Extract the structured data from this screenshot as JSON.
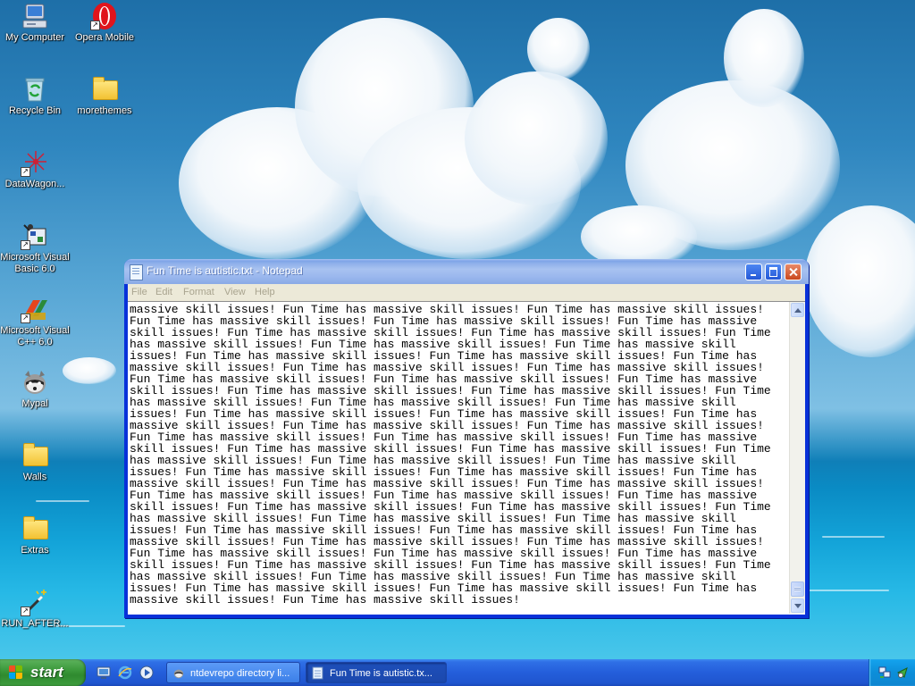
{
  "desktop": {
    "icons": [
      {
        "label": "My Computer",
        "icon": "my-computer-icon"
      },
      {
        "label": "Opera Mobile",
        "icon": "opera-icon"
      },
      {
        "label": "Recycle Bin",
        "icon": "recycle-bin-icon"
      },
      {
        "label": "morethemes",
        "icon": "folder-icon"
      },
      {
        "label": "DataWagon...",
        "icon": "datawagon-icon"
      },
      {
        "label": "Microsoft Visual Basic 6.0",
        "icon": "visual-basic-icon"
      },
      {
        "label": "Microsoft Visual C++ 6.0",
        "icon": "visual-cpp-icon"
      },
      {
        "label": "Mypal",
        "icon": "mypal-icon"
      },
      {
        "label": "Walls",
        "icon": "folder-icon"
      },
      {
        "label": "Extras",
        "icon": "folder-icon"
      },
      {
        "label": "RUN_AFTER...",
        "icon": "wand-icon"
      }
    ]
  },
  "notepad": {
    "title": "Fun Time is autistic.txt - Notepad",
    "menu": [
      "File",
      "Edit",
      "Format",
      "View",
      "Help"
    ],
    "text_lines": [
      "massive skill issues! Fun Time has massive skill issues! Fun Time has massive skill issues!",
      "Fun Time has massive skill issues! Fun Time has massive skill issues! Fun Time has massive",
      "skill issues! Fun Time has massive skill issues! Fun Time has massive skill issues! Fun Time",
      "has massive skill issues! Fun Time has massive skill issues! Fun Time has massive skill",
      "issues! Fun Time has massive skill issues! Fun Time has massive skill issues! Fun Time has",
      "massive skill issues! Fun Time has massive skill issues! Fun Time has massive skill issues!",
      "Fun Time has massive skill issues! Fun Time has massive skill issues! Fun Time has massive",
      "skill issues! Fun Time has massive skill issues! Fun Time has massive skill issues! Fun Time",
      "has massive skill issues! Fun Time has massive skill issues! Fun Time has massive skill",
      "issues! Fun Time has massive skill issues! Fun Time has massive skill issues! Fun Time has",
      "massive skill issues! Fun Time has massive skill issues! Fun Time has massive skill issues!",
      "Fun Time has massive skill issues! Fun Time has massive skill issues! Fun Time has massive",
      "skill issues! Fun Time has massive skill issues! Fun Time has massive skill issues! Fun Time",
      "has massive skill issues! Fun Time has massive skill issues! Fun Time has massive skill",
      "issues! Fun Time has massive skill issues! Fun Time has massive skill issues! Fun Time has",
      "massive skill issues! Fun Time has massive skill issues! Fun Time has massive skill issues!",
      "Fun Time has massive skill issues! Fun Time has massive skill issues! Fun Time has massive",
      "skill issues! Fun Time has massive skill issues! Fun Time has massive skill issues! Fun Time",
      "has massive skill issues! Fun Time has massive skill issues! Fun Time has massive skill",
      "issues! Fun Time has massive skill issues! Fun Time has massive skill issues! Fun Time has",
      "massive skill issues! Fun Time has massive skill issues! Fun Time has massive skill issues!",
      "Fun Time has massive skill issues! Fun Time has massive skill issues! Fun Time has massive",
      "skill issues! Fun Time has massive skill issues! Fun Time has massive skill issues! Fun Time",
      "has massive skill issues! Fun Time has massive skill issues! Fun Time has massive skill",
      "issues! Fun Time has massive skill issues! Fun Time has massive skill issues! Fun Time has",
      "massive skill issues! Fun Time has massive skill issues!"
    ]
  },
  "taskbar": {
    "start_label": "start",
    "quicklaunch": [
      "desktop-icon",
      "internet-explorer-icon",
      "media-player-icon"
    ],
    "buttons": [
      {
        "label": "ntdevrepo directory li...",
        "icon": "mypal-icon",
        "active": false
      },
      {
        "label": "Fun Time is autistic.tx...",
        "icon": "notepad-icon",
        "active": true
      }
    ],
    "tray": [
      "network-icon",
      "system-tray-icon"
    ]
  },
  "colors": {
    "xp_blue_title": "#0831d9",
    "start_green": "#3c9a3c",
    "taskbar_blue": "#245edb",
    "tray_blue": "#0c8ed9"
  }
}
